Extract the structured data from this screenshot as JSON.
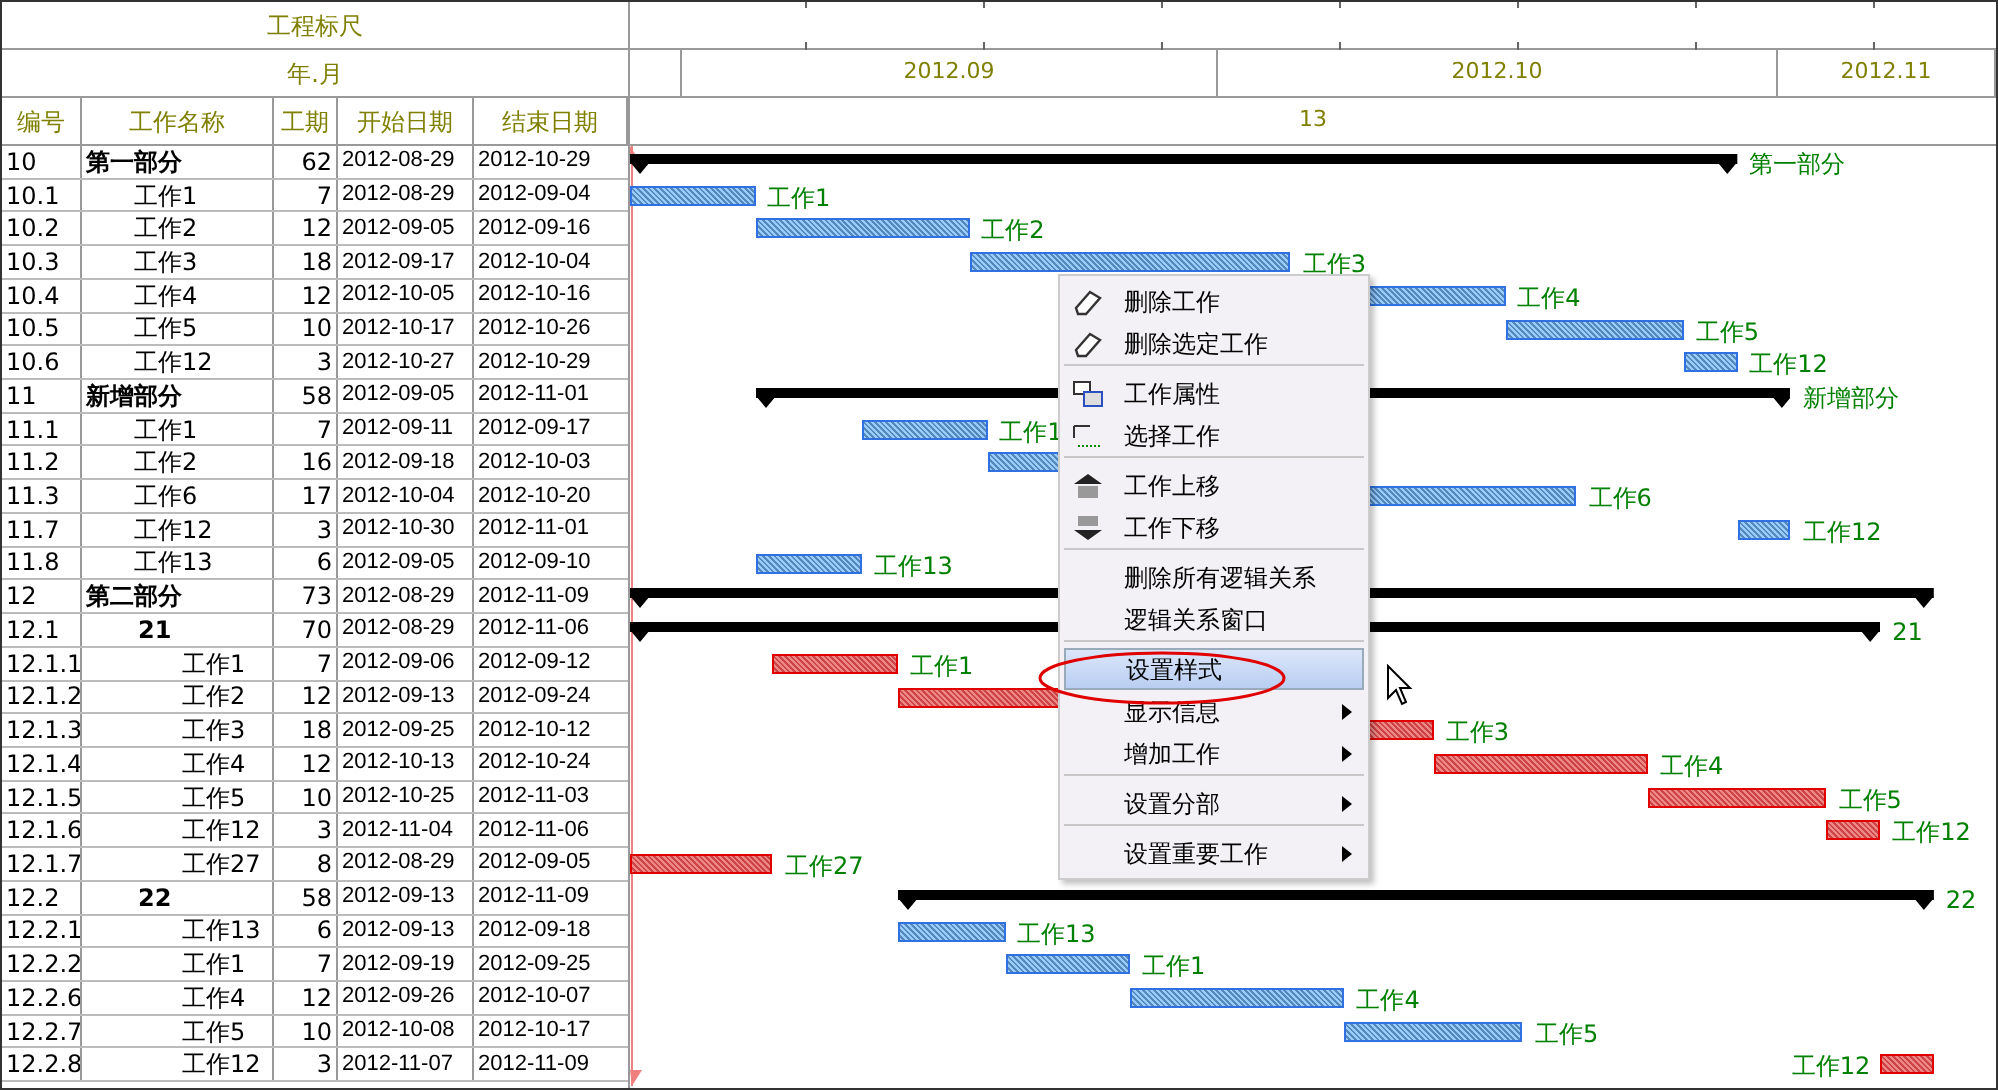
{
  "scale": {
    "title": "工程标尺",
    "month_label": "年.月",
    "months": [
      "2012.09",
      "2012.10",
      "2012.11"
    ],
    "week": "13"
  },
  "columns": [
    "编号",
    "工作名称",
    "工期",
    "开始日期",
    "结束日期"
  ],
  "rows": [
    {
      "id": "10",
      "name": "第一部分",
      "duration": "62",
      "start": "2012-08-29",
      "end": "2012-10-29",
      "kind": "group",
      "bar_label": "第一部分",
      "children": [
        {
          "id": "10.1",
          "name": "工作1",
          "duration": "7",
          "start": "2012-08-29",
          "end": "2012-09-04",
          "kind": "task",
          "critical": false,
          "bar_label": "工作1"
        },
        {
          "id": "10.2",
          "name": "工作2",
          "duration": "12",
          "start": "2012-09-05",
          "end": "2012-09-16",
          "kind": "task",
          "critical": false,
          "bar_label": "工作2"
        },
        {
          "id": "10.3",
          "name": "工作3",
          "duration": "18",
          "start": "2012-09-17",
          "end": "2012-10-04",
          "kind": "task",
          "critical": false,
          "bar_label": "工作3"
        },
        {
          "id": "10.4",
          "name": "工作4",
          "duration": "12",
          "start": "2012-10-05",
          "end": "2012-10-16",
          "kind": "task",
          "critical": false,
          "bar_label": "工作4"
        },
        {
          "id": "10.5",
          "name": "工作5",
          "duration": "10",
          "start": "2012-10-17",
          "end": "2012-10-26",
          "kind": "task",
          "critical": false,
          "bar_label": "工作5"
        },
        {
          "id": "10.6",
          "name": "工作12",
          "duration": "3",
          "start": "2012-10-27",
          "end": "2012-10-29",
          "kind": "task",
          "critical": false,
          "bar_label": "工作12"
        }
      ]
    },
    {
      "id": "11",
      "name": "新增部分",
      "duration": "58",
      "start": "2012-09-05",
      "end": "2012-11-01",
      "kind": "group",
      "bar_label": "新增部分",
      "children": [
        {
          "id": "11.1",
          "name": "工作1",
          "duration": "7",
          "start": "2012-09-11",
          "end": "2012-09-17",
          "kind": "task",
          "critical": false,
          "bar_label": "工作1"
        },
        {
          "id": "11.2",
          "name": "工作2",
          "duration": "16",
          "start": "2012-09-18",
          "end": "2012-10-03",
          "kind": "task",
          "critical": false
        },
        {
          "id": "11.3",
          "name": "工作6",
          "duration": "17",
          "start": "2012-10-04",
          "end": "2012-10-20",
          "kind": "task",
          "critical": false,
          "bar_label": "工作6"
        },
        {
          "id": "11.7",
          "name": "工作12",
          "duration": "3",
          "start": "2012-10-30",
          "end": "2012-11-01",
          "kind": "task",
          "critical": false,
          "bar_label": "工作12"
        },
        {
          "id": "11.8",
          "name": "工作13",
          "duration": "6",
          "start": "2012-09-05",
          "end": "2012-09-10",
          "kind": "task",
          "critical": false,
          "bar_label": "工作13"
        }
      ]
    },
    {
      "id": "12",
      "name": "第二部分",
      "duration": "73",
      "start": "2012-08-29",
      "end": "2012-11-09",
      "kind": "group",
      "children": [
        {
          "id": "12.1",
          "name": "21",
          "duration": "70",
          "start": "2012-08-29",
          "end": "2012-11-06",
          "kind": "group",
          "bar_label": "21",
          "children": [
            {
              "id": "12.1.1",
              "name": "工作1",
              "duration": "7",
              "start": "2012-09-06",
              "end": "2012-09-12",
              "kind": "task",
              "critical": true,
              "bar_label": "工作1"
            },
            {
              "id": "12.1.2",
              "name": "工作2",
              "duration": "12",
              "start": "2012-09-13",
              "end": "2012-09-24",
              "kind": "task",
              "critical": true
            },
            {
              "id": "12.1.3",
              "name": "工作3",
              "duration": "18",
              "start": "2012-09-25",
              "end": "2012-10-12",
              "kind": "task",
              "critical": true,
              "bar_label": "工作3"
            },
            {
              "id": "12.1.4",
              "name": "工作4",
              "duration": "12",
              "start": "2012-10-13",
              "end": "2012-10-24",
              "kind": "task",
              "critical": true,
              "bar_label": "工作4"
            },
            {
              "id": "12.1.5",
              "name": "工作5",
              "duration": "10",
              "start": "2012-10-25",
              "end": "2012-11-03",
              "kind": "task",
              "critical": true,
              "bar_label": "工作5"
            },
            {
              "id": "12.1.6",
              "name": "工作12",
              "duration": "3",
              "start": "2012-11-04",
              "end": "2012-11-06",
              "kind": "task",
              "critical": true,
              "bar_label": "工作12"
            },
            {
              "id": "12.1.7",
              "name": "工作27",
              "duration": "8",
              "start": "2012-08-29",
              "end": "2012-09-05",
              "kind": "task",
              "critical": true,
              "bar_label": "工作27"
            }
          ]
        },
        {
          "id": "12.2",
          "name": "22",
          "duration": "58",
          "start": "2012-09-13",
          "end": "2012-11-09",
          "kind": "group",
          "bar_label": "22",
          "children": [
            {
              "id": "12.2.1",
              "name": "工作13",
              "duration": "6",
              "start": "2012-09-13",
              "end": "2012-09-18",
              "kind": "task",
              "critical": false,
              "bar_label": "工作13"
            },
            {
              "id": "12.2.2",
              "name": "工作1",
              "duration": "7",
              "start": "2012-09-19",
              "end": "2012-09-25",
              "kind": "task",
              "critical": false,
              "bar_label": "工作1"
            },
            {
              "id": "12.2.6",
              "name": "工作4",
              "duration": "12",
              "start": "2012-09-26",
              "end": "2012-10-07",
              "kind": "task",
              "critical": false,
              "bar_label": "工作4"
            },
            {
              "id": "12.2.7",
              "name": "工作5",
              "duration": "10",
              "start": "2012-10-08",
              "end": "2012-10-17",
              "kind": "task",
              "critical": false,
              "bar_label": "工作5"
            },
            {
              "id": "12.2.8",
              "name": "工作12",
              "duration": "3",
              "start": "2012-11-07",
              "end": "2012-11-09",
              "kind": "task",
              "critical": true,
              "bar_label": "工作12"
            }
          ]
        }
      ]
    }
  ],
  "context_menu": [
    {
      "label": "删除工作",
      "selected": false,
      "submenu": false,
      "separator_after": false
    },
    {
      "label": "删除选定工作",
      "selected": false,
      "submenu": false,
      "separator_after": true
    },
    {
      "label": "工作属性",
      "selected": false,
      "submenu": false,
      "separator_after": false
    },
    {
      "label": "选择工作",
      "selected": false,
      "submenu": false,
      "separator_after": true
    },
    {
      "label": "工作上移",
      "selected": false,
      "submenu": false,
      "separator_after": false
    },
    {
      "label": "工作下移",
      "selected": false,
      "submenu": false,
      "separator_after": true
    },
    {
      "label": "删除所有逻辑关系",
      "selected": false,
      "submenu": false,
      "separator_after": false
    },
    {
      "label": "逻辑关系窗口",
      "selected": false,
      "submenu": false,
      "separator_after": true
    },
    {
      "label": "设置样式",
      "selected": true,
      "submenu": false,
      "separator_after": false
    },
    {
      "label": "显示信息",
      "selected": false,
      "submenu": true,
      "separator_after": false
    },
    {
      "label": "增加工作",
      "selected": false,
      "submenu": true,
      "separator_after": true
    },
    {
      "label": "设置分部",
      "selected": false,
      "submenu": true,
      "separator_after": true
    },
    {
      "label": "设置重要工作",
      "selected": false,
      "submenu": true,
      "separator_after": false
    }
  ]
}
